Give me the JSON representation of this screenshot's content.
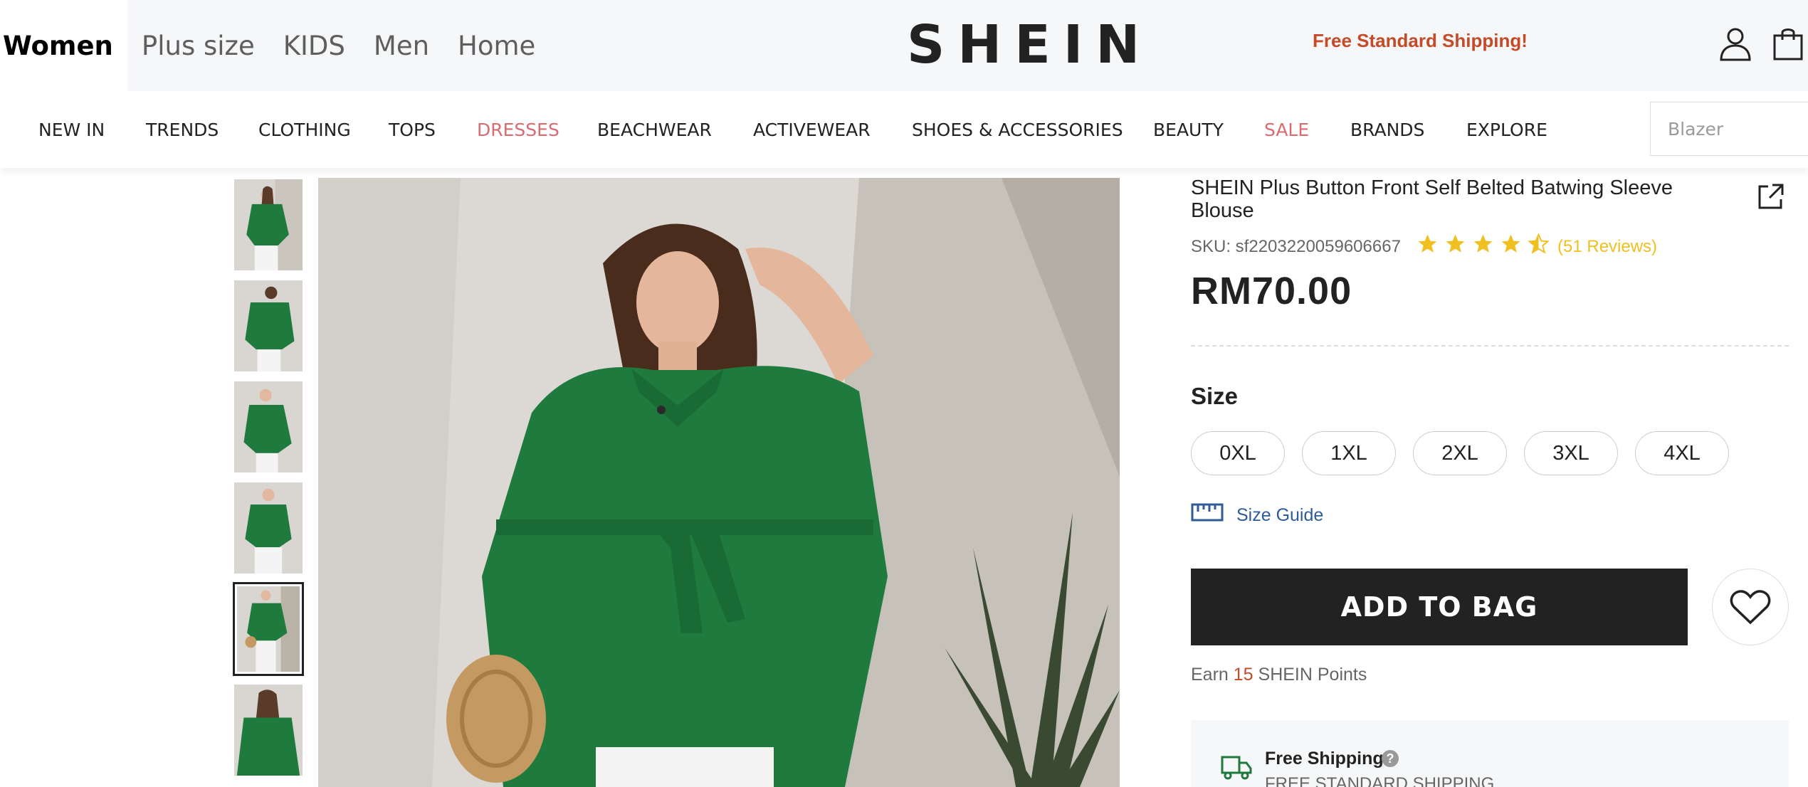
{
  "header": {
    "category_tabs": [
      {
        "label": "Women",
        "active": true
      },
      {
        "label": "Plus size"
      },
      {
        "label": "KIDS"
      },
      {
        "label": "Men"
      },
      {
        "label": "Home"
      }
    ],
    "logo": "SHEIN",
    "promo": "Free Standard Shipping!",
    "icons": [
      "user-icon",
      "bag-icon"
    ]
  },
  "nav": {
    "items": [
      {
        "label": "NEW IN"
      },
      {
        "label": "TRENDS"
      },
      {
        "label": "CLOTHING"
      },
      {
        "label": "TOPS"
      },
      {
        "label": "DRESSES",
        "color": "#d96b72"
      },
      {
        "label": "BEACHWEAR"
      },
      {
        "label": "ACTIVEWEAR"
      },
      {
        "label": "SHOES & ACCESSORIES"
      },
      {
        "label": "BEAUTY"
      },
      {
        "label": "SALE",
        "color": "#d96b72"
      },
      {
        "label": "BRANDS"
      },
      {
        "label": "EXPLORE"
      }
    ],
    "search_placeholder": "Blazer"
  },
  "gallery": {
    "thumbnail_count": 6,
    "active_thumbnail": 5
  },
  "product": {
    "title": "SHEIN Plus Button Front Self Belted Batwing Sleeve Blouse",
    "sku": "SKU: sf2203220059606667",
    "rating": 4.5,
    "reviews": "(51 Reviews)",
    "price": "RM70.00",
    "size_title": "Size",
    "sizes": [
      "0XL",
      "1XL",
      "2XL",
      "3XL",
      "4XL"
    ],
    "size_guide": "Size Guide",
    "add_to_bag": "ADD TO BAG",
    "points": {
      "prefix": "Earn",
      "value": "15",
      "suffix": "SHEIN Points"
    },
    "shipping": {
      "title": "Free Shipping",
      "subtitle": "FREE STANDARD SHIPPING"
    }
  },
  "colors": {
    "accent_red": "#d96b72",
    "promo_orange": "#c44a28",
    "star_yellow": "#f0c020",
    "link_blue": "#2e5b99",
    "garment_green": "#1f7a3e"
  }
}
